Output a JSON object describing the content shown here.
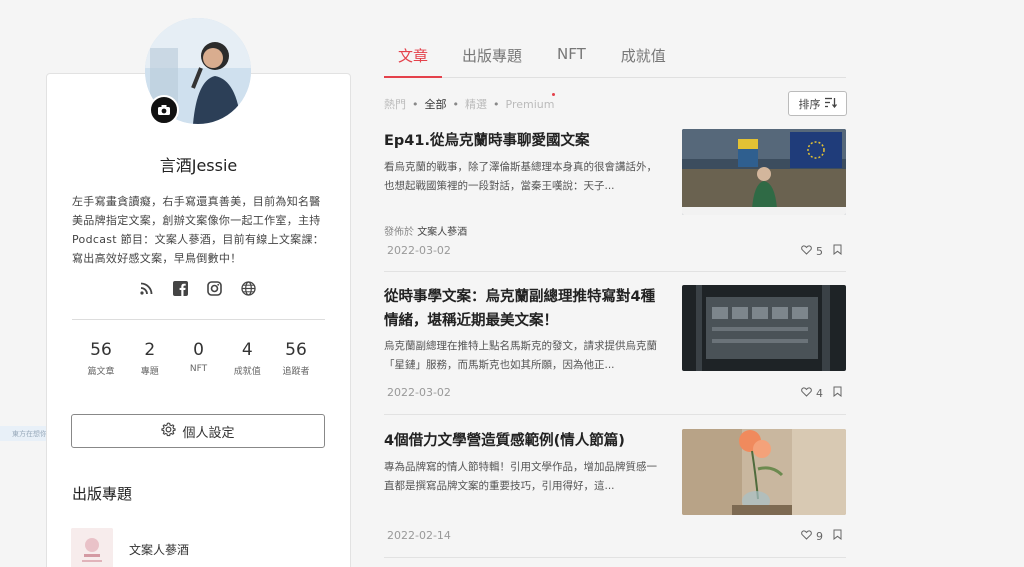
{
  "profile": {
    "name": "言酒Jessie",
    "bio": "左手寫畫貪讀癡，右手寫還真善美，目前為知名醫美品牌指定文案，創辦文案像你一起工作室，主持 Podcast 節目：文案人蔘酒，目前有線上文案課：寫出高效好感文案，早鳥倒數中！",
    "social_icons": [
      "rss-icon",
      "facebook-icon",
      "instagram-icon",
      "globe-icon"
    ],
    "stats": [
      {
        "value": "56",
        "label": "篇文章"
      },
      {
        "value": "2",
        "label": "專題"
      },
      {
        "value": "0",
        "label": "NFT"
      },
      {
        "value": "4",
        "label": "成就值"
      },
      {
        "value": "56",
        "label": "追蹤者"
      }
    ],
    "settings_label": "個人設定",
    "published_section_title": "出版專題",
    "published_items": [
      {
        "name": "文案人蔘酒"
      }
    ]
  },
  "faint_tag": "東方在想你(ti)",
  "tabs": [
    {
      "label": "文章",
      "active": true
    },
    {
      "label": "出版專題",
      "active": false
    },
    {
      "label": "NFT",
      "active": false
    },
    {
      "label": "成就值",
      "active": false
    }
  ],
  "filters": {
    "items": [
      "熱門",
      "全部",
      "精選",
      "Premium"
    ],
    "selected": "全部"
  },
  "sort_label": "排序",
  "articles": [
    {
      "title": "Ep41.從烏克蘭時事聊愛國文案",
      "excerpt": "看烏克蘭的戰事，除了澤倫斯基總理本身真的很會講話外，也想起戰國策裡的一段對話，當秦王嘆說：天子...",
      "published_in_prefix": "發佈於",
      "published_in": "文案人蔘酒",
      "date": "2022-03-02",
      "likes": "5"
    },
    {
      "title": "從時事學文案：烏克蘭副總理推特寫對4種情緒，堪稱近期最美文案！",
      "excerpt": "烏克蘭副總理在推特上點名馬斯克的發文，請求提供烏克蘭「星鏈」服務，而馬斯克也如其所願，因為他正...",
      "date": "2022-03-02",
      "likes": "4"
    },
    {
      "title": "4個借力文學營造質感範例(情人節篇)",
      "excerpt": "專為品牌寫的情人節特輯！引用文學作品，增加品牌質感一直都是撰寫品牌文案的重要技巧，引用得好，這...",
      "date": "2022-02-14",
      "likes": "9"
    }
  ],
  "colors": {
    "accent": "#e4414b",
    "background": "#f5f5f5"
  }
}
